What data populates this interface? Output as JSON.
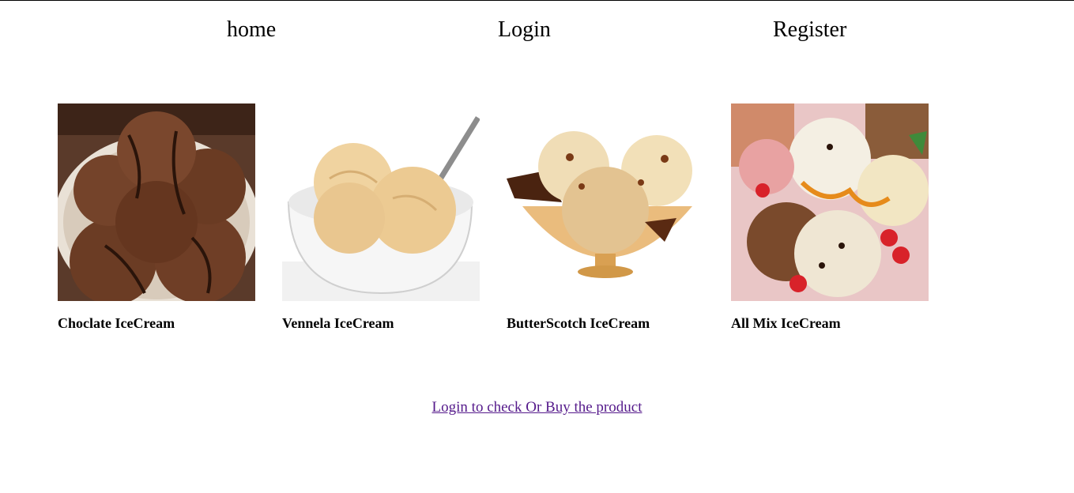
{
  "nav": {
    "home": "home",
    "login": "Login",
    "register": "Register"
  },
  "products": [
    {
      "name": "Choclate IceCream",
      "image": "chocolate-icecream-bowl"
    },
    {
      "name": "Vennela IceCream",
      "image": "vanilla-icecream-bowl"
    },
    {
      "name": "ButterScotch IceCream",
      "image": "butterscotch-icecream-cup"
    },
    {
      "name": "All Mix IceCream",
      "image": "mixed-icecream-scoops"
    }
  ],
  "cta": {
    "label": "Login to check Or Buy the product"
  },
  "colors": {
    "link_visited": "#551a8b",
    "text": "#000000",
    "background": "#ffffff"
  }
}
